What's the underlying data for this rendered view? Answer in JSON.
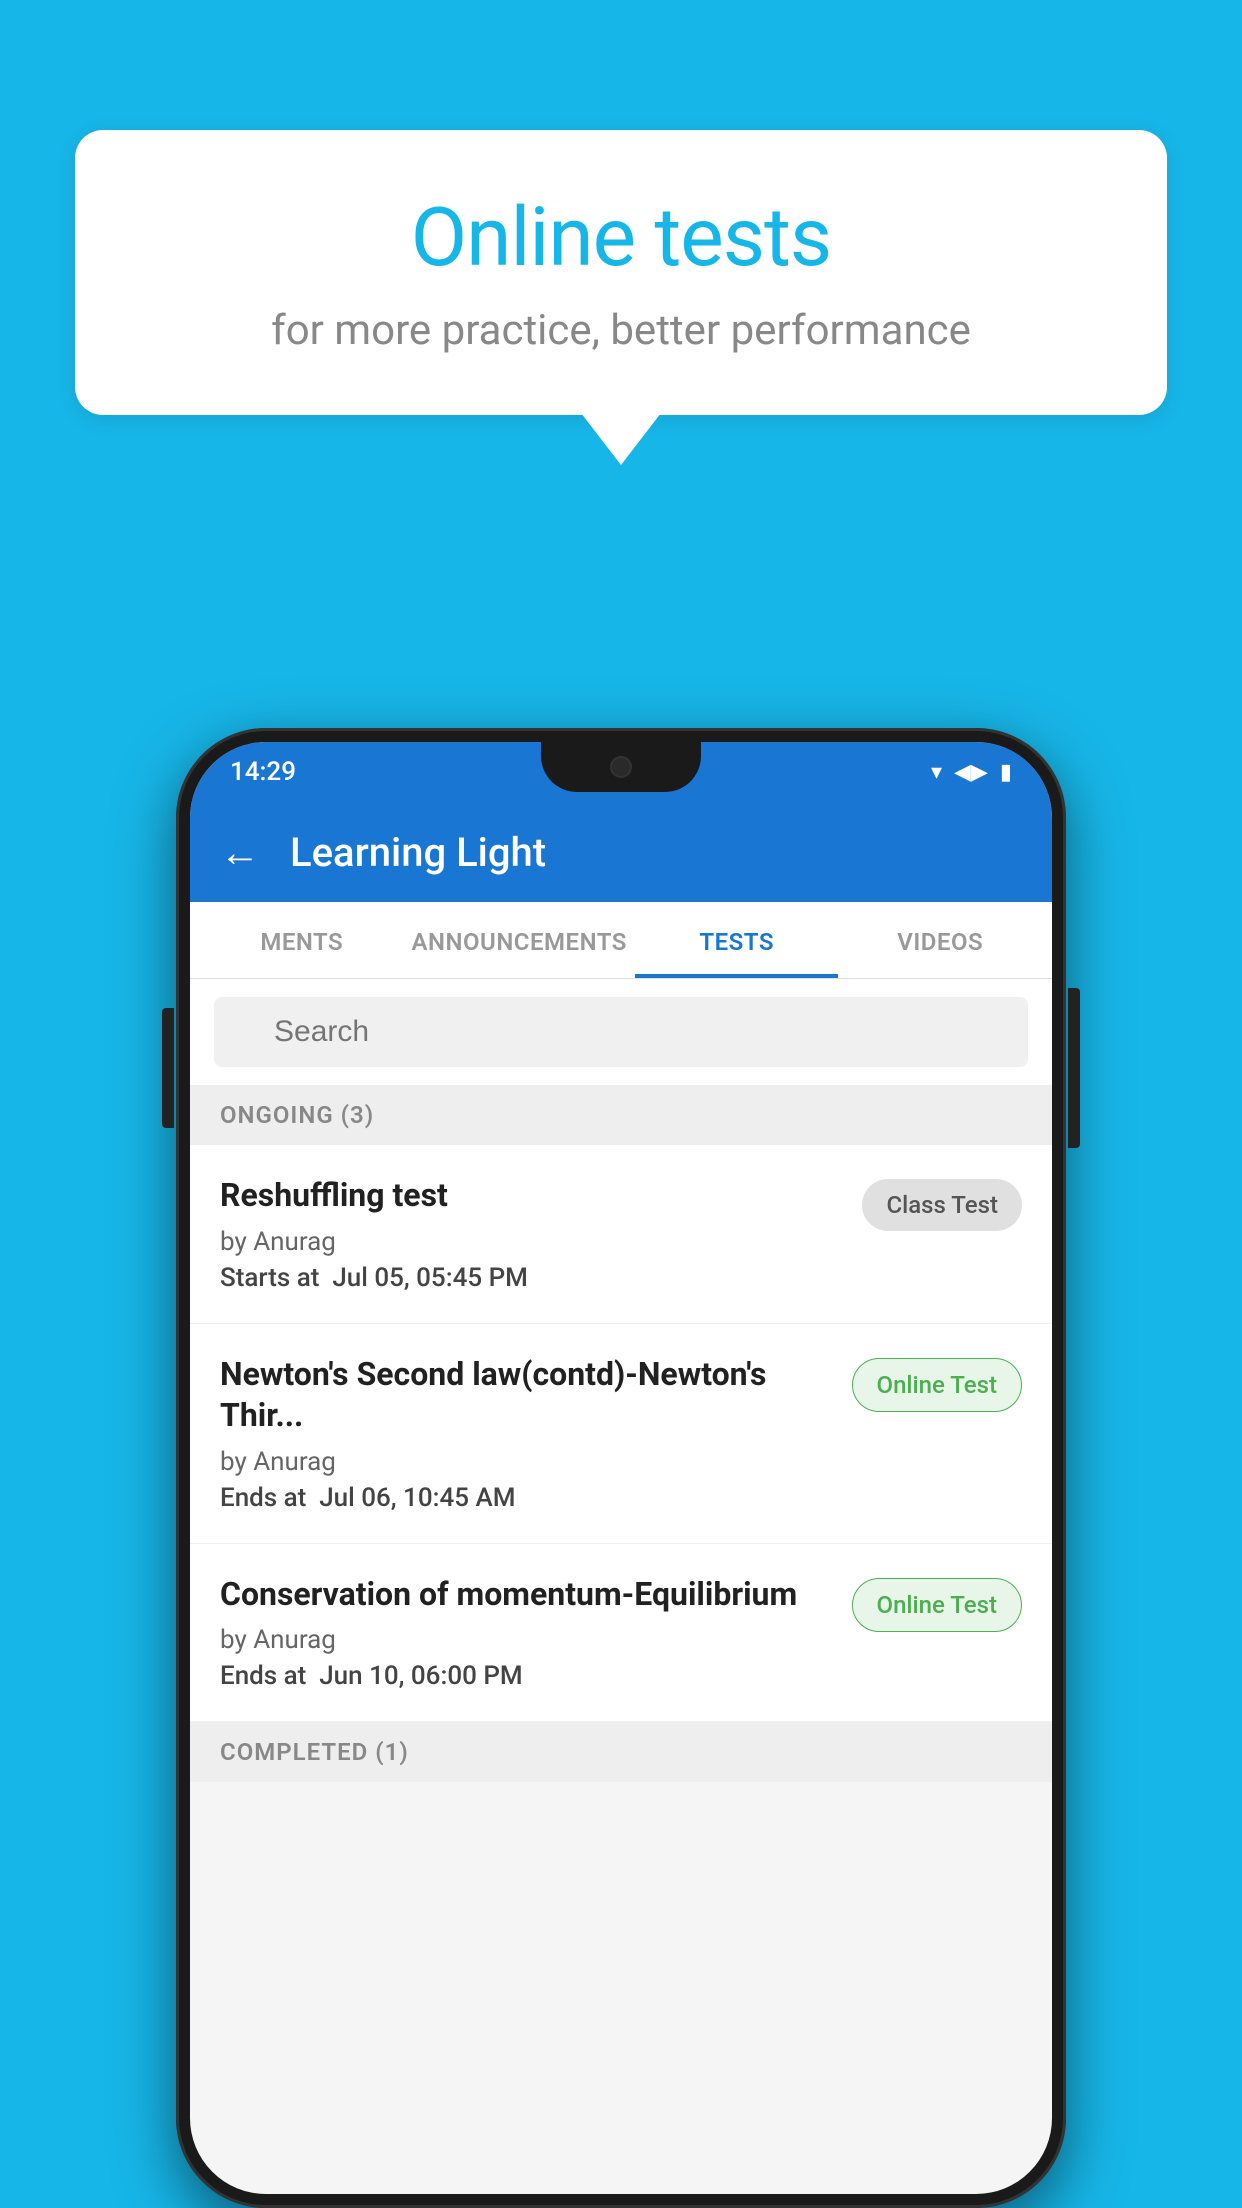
{
  "background_color": "#17b6e8",
  "bubble": {
    "title": "Online tests",
    "subtitle": "for more practice, better performance"
  },
  "status_bar": {
    "time": "14:29",
    "wifi": "▾",
    "signal": "▲",
    "battery": "▮"
  },
  "app_bar": {
    "back_label": "←",
    "title": "Learning Light"
  },
  "tabs": [
    {
      "label": "MENTS",
      "active": false
    },
    {
      "label": "ANNOUNCEMENTS",
      "active": false
    },
    {
      "label": "TESTS",
      "active": true
    },
    {
      "label": "VIDEOS",
      "active": false
    }
  ],
  "search": {
    "placeholder": "Search"
  },
  "ongoing_section": {
    "header": "ONGOING (3)",
    "items": [
      {
        "title": "Reshuffling test",
        "by": "by Anurag",
        "date_label": "Starts at",
        "date_value": "Jul 05, 05:45 PM",
        "badge": "Class Test",
        "badge_type": "class"
      },
      {
        "title": "Newton's Second law(contd)-Newton's Thir...",
        "by": "by Anurag",
        "date_label": "Ends at",
        "date_value": "Jul 06, 10:45 AM",
        "badge": "Online Test",
        "badge_type": "online"
      },
      {
        "title": "Conservation of momentum-Equilibrium",
        "by": "by Anurag",
        "date_label": "Ends at",
        "date_value": "Jun 10, 06:00 PM",
        "badge": "Online Test",
        "badge_type": "online"
      }
    ]
  },
  "completed_section": {
    "header": "COMPLETED (1)"
  }
}
